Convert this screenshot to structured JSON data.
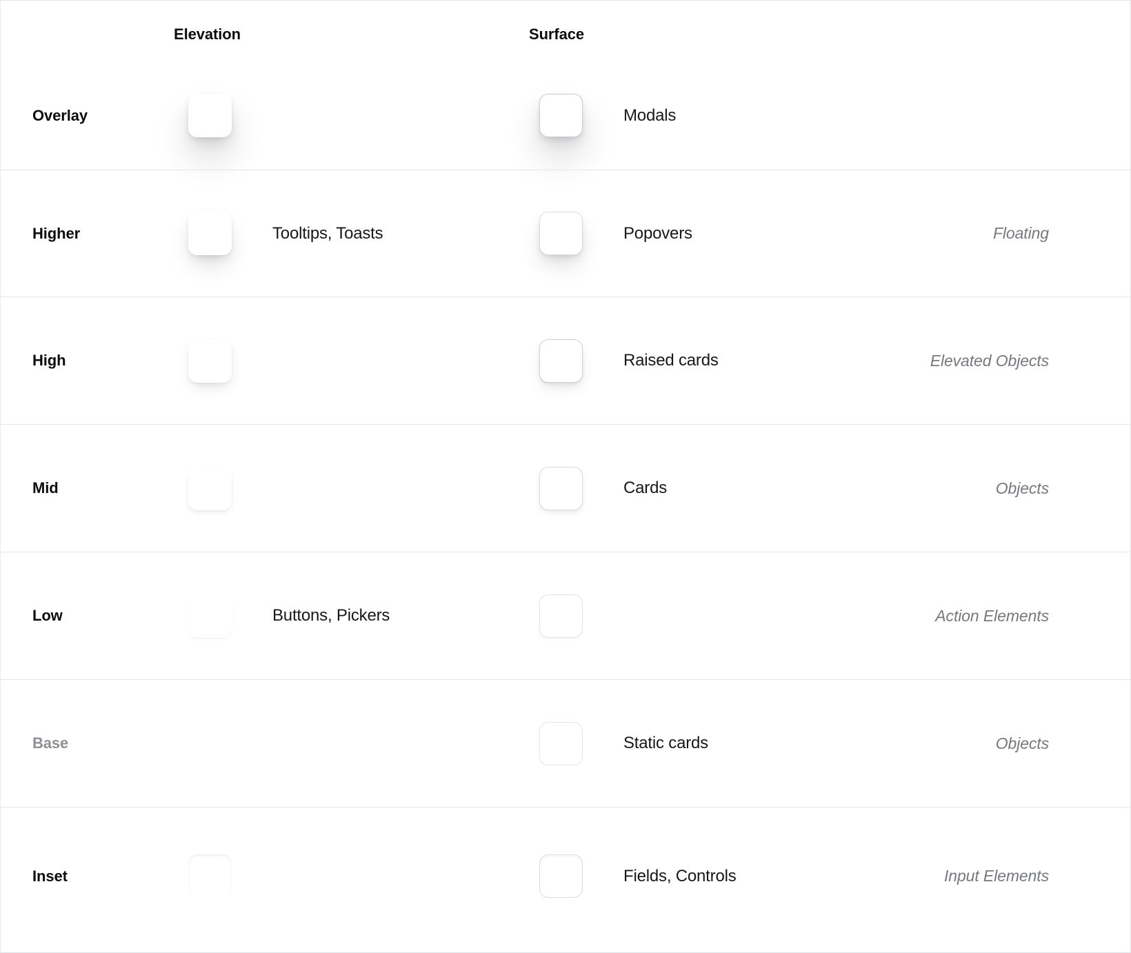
{
  "header": {
    "row_label_column": "",
    "elevation_label": "Elevation",
    "surface_label": "Surface"
  },
  "colors": {
    "text_primary": "#0d0d0f",
    "text_body": "#16181c",
    "text_muted": "#8d9095",
    "text_category": "#75787d",
    "divider": "#e4e5e7",
    "surface_border": "#d9dbde",
    "swatch_fill": "#ffffff"
  },
  "rows": [
    {
      "level": "Overlay",
      "level_muted": false,
      "elevation_usage": "",
      "surface_usage": "Modals",
      "category": "",
      "has_elevation_swatch": true,
      "has_surface_swatch": true,
      "elevation_token": "e-overlay",
      "surface_token": "s-overlay"
    },
    {
      "level": "Higher",
      "level_muted": false,
      "elevation_usage": "Tooltips, Toasts",
      "surface_usage": "Popovers",
      "category": "Floating",
      "has_elevation_swatch": true,
      "has_surface_swatch": true,
      "elevation_token": "e-higher",
      "surface_token": "s-higher"
    },
    {
      "level": "High",
      "level_muted": false,
      "elevation_usage": "",
      "surface_usage": "Raised cards",
      "category": "Elevated Objects",
      "has_elevation_swatch": true,
      "has_surface_swatch": true,
      "elevation_token": "e-high",
      "surface_token": "s-high"
    },
    {
      "level": "Mid",
      "level_muted": false,
      "elevation_usage": "",
      "surface_usage": "Cards",
      "category": "Objects",
      "has_elevation_swatch": true,
      "has_surface_swatch": true,
      "elevation_token": "e-mid",
      "surface_token": "s-mid"
    },
    {
      "level": "Low",
      "level_muted": false,
      "elevation_usage": "Buttons, Pickers",
      "surface_usage": "",
      "category": "Action Elements",
      "has_elevation_swatch": true,
      "has_surface_swatch": true,
      "elevation_token": "e-low",
      "surface_token": "s-low"
    },
    {
      "level": "Base",
      "level_muted": true,
      "elevation_usage": "",
      "surface_usage": "Static cards",
      "category": "Objects",
      "has_elevation_swatch": false,
      "has_surface_swatch": true,
      "elevation_token": "e-none",
      "surface_token": "s-base"
    },
    {
      "level": "Inset",
      "level_muted": false,
      "elevation_usage": "",
      "surface_usage": "Fields, Controls",
      "category": "Input Elements",
      "has_elevation_swatch": true,
      "has_surface_swatch": true,
      "elevation_token": "e-inset",
      "surface_token": "s-inset"
    }
  ]
}
